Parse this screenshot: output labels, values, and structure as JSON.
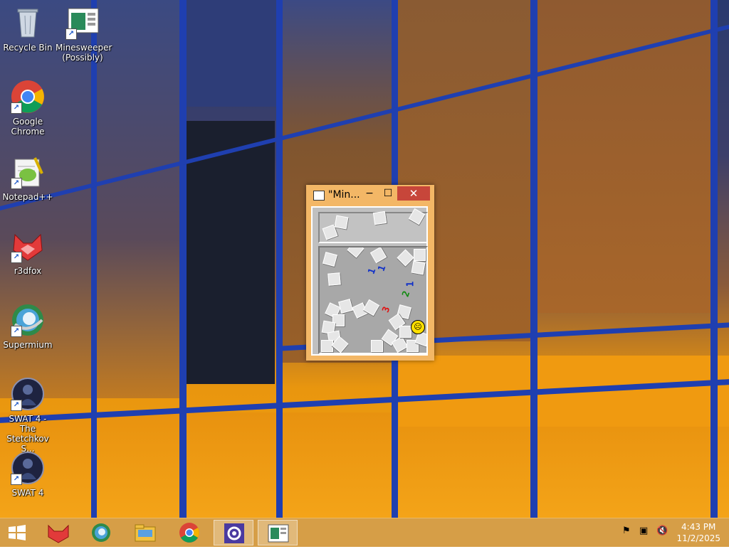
{
  "desktop": {
    "icons": [
      {
        "label": "Recycle Bin"
      },
      {
        "label": "Minesweeper\n(Possibly)"
      },
      {
        "label": "Google\nChrome"
      },
      {
        "label": "Notepad++"
      },
      {
        "label": "r3dfox"
      },
      {
        "label": "Supermium"
      },
      {
        "label": "SWAT 4 - The\nStetchkov S..."
      },
      {
        "label": "SWAT 4"
      }
    ]
  },
  "window": {
    "title": "\"Min...",
    "minimize_label": "−",
    "maximize_label": "☐",
    "close_label": "✕",
    "numbers": [
      {
        "text": "1",
        "color": "#1030c8"
      },
      {
        "text": "1",
        "color": "#1030c8"
      },
      {
        "text": "1",
        "color": "#1030c8"
      },
      {
        "text": "2",
        "color": "#108a10"
      },
      {
        "text": "3",
        "color": "#e01010"
      }
    ]
  },
  "taskbar": {
    "clock_time": "4:43 PM",
    "clock_date": "11/2/2025"
  },
  "colors": {
    "accent": "#c7463a",
    "taskbar": "#d29637",
    "mullion": "#1f3fb0"
  }
}
